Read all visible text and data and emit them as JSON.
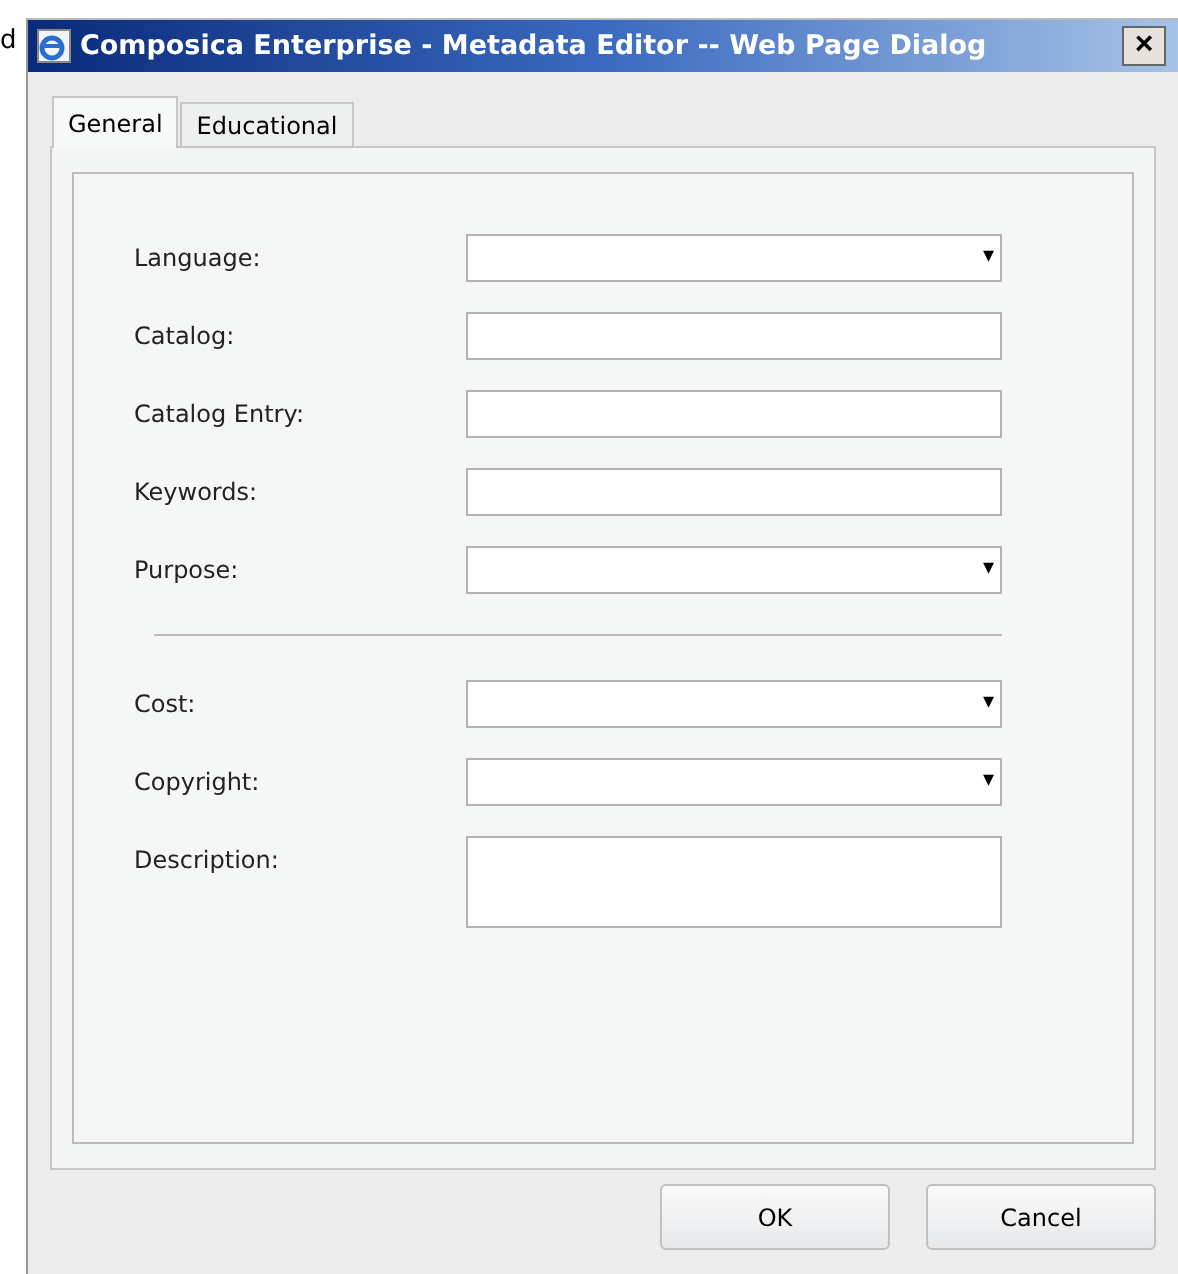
{
  "edge_text": "d",
  "window": {
    "title": "Composica Enterprise - Metadata Editor -- Web Page Dialog",
    "close": "×"
  },
  "tabs": [
    {
      "label": "General",
      "selected": true
    },
    {
      "label": "Educational",
      "selected": false
    }
  ],
  "groups": [
    {
      "fields": [
        {
          "label": "Language:",
          "kind": "select",
          "arrow": "▾"
        },
        {
          "label": "Catalog:",
          "kind": "text"
        },
        {
          "label": "Catalog Entry:",
          "kind": "text"
        },
        {
          "label": "Keywords:",
          "kind": "text"
        },
        {
          "label": "Purpose:",
          "kind": "select",
          "arrow": "▾"
        }
      ]
    },
    {
      "fields": [
        {
          "label": "Cost:",
          "kind": "select",
          "arrow": "▾"
        },
        {
          "label": "Copyright:",
          "kind": "select",
          "arrow": "▾"
        },
        {
          "label": "Description:",
          "kind": "textarea"
        }
      ]
    }
  ],
  "buttons": [
    "OK",
    "Cancel"
  ]
}
